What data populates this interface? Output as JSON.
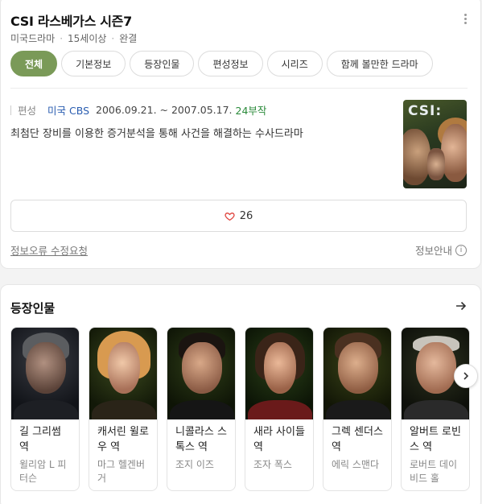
{
  "header": {
    "title": "CSI 라스베가스 시즌7",
    "meta": [
      "미국드라마",
      "15세이상",
      "완결"
    ]
  },
  "tabs": [
    {
      "label": "전체",
      "active": true
    },
    {
      "label": "기본정보"
    },
    {
      "label": "등장인물"
    },
    {
      "label": "편성정보"
    },
    {
      "label": "시리즈"
    },
    {
      "label": "함께 볼만한 드라마"
    }
  ],
  "broadcast": {
    "label": "편성",
    "network": "미국 CBS",
    "dates": "2006.09.21. ~ 2007.05.17.",
    "episodes": "24부작"
  },
  "synopsis": "최첨단 장비를 이용한 증거분석을 통해 사건을 해결하는 수사드라마",
  "poster": {
    "logo_text": "CSI:"
  },
  "like": {
    "count": "26",
    "icon": "heart-icon"
  },
  "footer": {
    "report": "정보오류 수정요청",
    "guide": "정보안내"
  },
  "cast_section": {
    "title": "등장인물",
    "people": [
      {
        "role": "길 그리썸 역",
        "actor": "윌리암 L 피터슨"
      },
      {
        "role": "캐서린 윌로우 역",
        "actor": "마그 헬겐버거"
      },
      {
        "role": "니콜라스 스톡스 역",
        "actor": "조지 이즈"
      },
      {
        "role": "새라 사이들 역",
        "actor": "조자 폭스"
      },
      {
        "role": "그렉 센더스 역",
        "actor": "에릭 스맨다"
      },
      {
        "role": "알버트 로빈스 역",
        "actor": "로버트 데이비드 홀"
      }
    ]
  },
  "colors": {
    "accent": "#7a9a58",
    "link": "#2a5db0",
    "episodes": "#2a8a3a",
    "heart": "#e0443e"
  }
}
